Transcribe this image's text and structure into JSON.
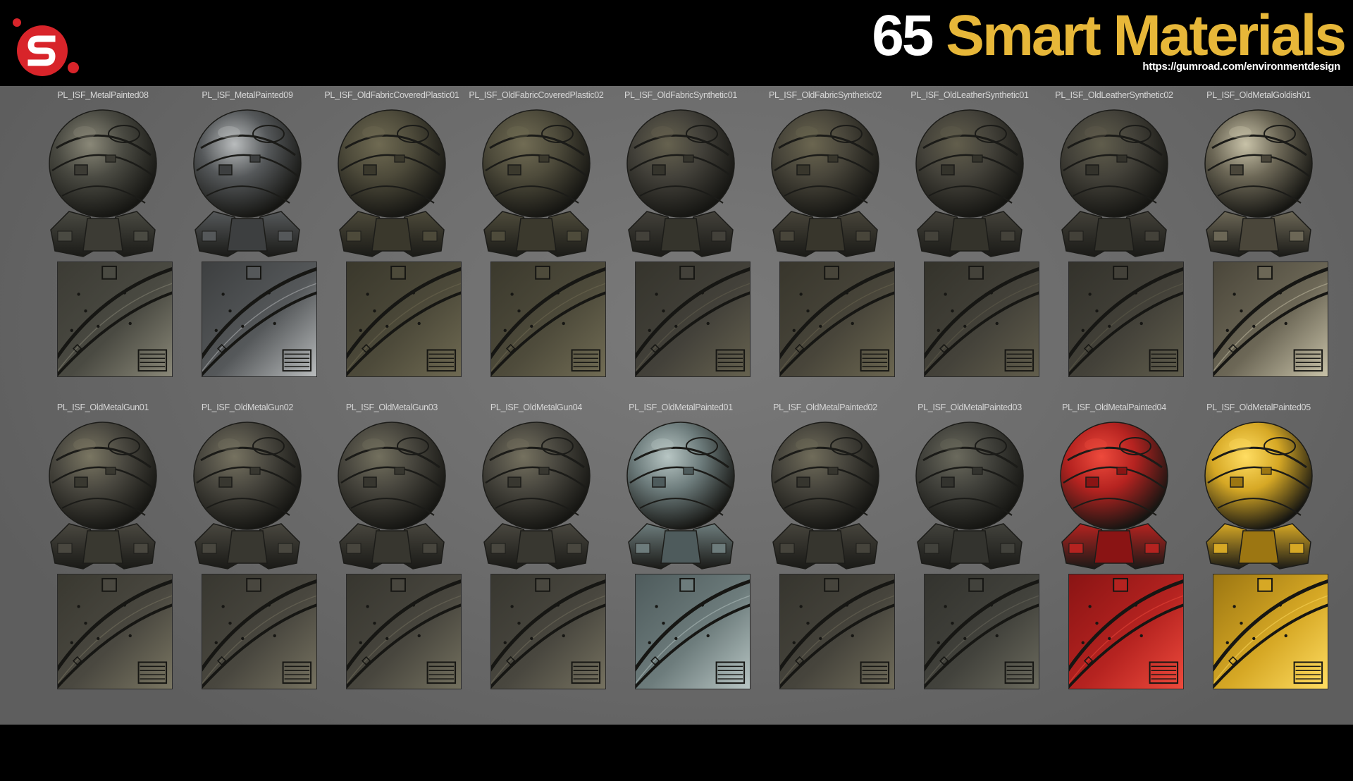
{
  "header": {
    "title_number": "65",
    "title_text": "Smart Materials",
    "url": "https://gumroad.com/environmentdesign",
    "logo_icon": "substance-s-logo-icon",
    "title_color": "#e7b739"
  },
  "rows": [
    {
      "materials": [
        {
          "name": "PL_ISF_MetalPainted08",
          "base": "#3c3b34",
          "hi": "#8a8878",
          "tint": "#4a4a42"
        },
        {
          "name": "PL_ISF_MetalPainted09",
          "base": "#3d3f40",
          "hi": "#b9bcbd",
          "tint": "#55585a"
        },
        {
          "name": "PL_ISF_OldFabricCoveredPlastic01",
          "base": "#3a382c",
          "hi": "#6f6a52",
          "tint": "#4d4a3a"
        },
        {
          "name": "PL_ISF_OldFabricCoveredPlastic02",
          "base": "#3b392d",
          "hi": "#716c54",
          "tint": "#4e4b3b"
        },
        {
          "name": "PL_ISF_OldFabricSynthetic01",
          "base": "#35342c",
          "hi": "#66624f",
          "tint": "#43413a"
        },
        {
          "name": "PL_ISF_OldFabricSynthetic02",
          "base": "#38362c",
          "hi": "#6b6650",
          "tint": "#48453a"
        },
        {
          "name": "PL_ISF_OldLeatherSynthetic01",
          "base": "#34332b",
          "hi": "#625e4c",
          "tint": "#44423a"
        },
        {
          "name": "PL_ISF_OldLeatherSynthetic02",
          "base": "#33322b",
          "hi": "#605d4c",
          "tint": "#434139"
        },
        {
          "name": "PL_ISF_OldMetalGoldish01",
          "base": "#4a463a",
          "hi": "#c8c2a8",
          "tint": "#6c6756"
        }
      ]
    },
    {
      "materials": [
        {
          "name": "PL_ISF_OldMetalGun01",
          "base": "#393830",
          "hi": "#7a7662",
          "tint": "#4a4840"
        },
        {
          "name": "PL_ISF_OldMetalGun02",
          "base": "#383730",
          "hi": "#767260",
          "tint": "#49473f"
        },
        {
          "name": "PL_ISF_OldMetalGun03",
          "base": "#37362f",
          "hi": "#73705e",
          "tint": "#48463e"
        },
        {
          "name": "PL_ISF_OldMetalGun04",
          "base": "#383730",
          "hi": "#75715f",
          "tint": "#49473f"
        },
        {
          "name": "PL_ISF_OldMetalPainted01",
          "base": "#4e5b5c",
          "hi": "#b8c6c4",
          "tint": "#6d7c7c"
        },
        {
          "name": "PL_ISF_OldMetalPainted02",
          "base": "#36352e",
          "hi": "#706c5a",
          "tint": "#46443c"
        },
        {
          "name": "PL_ISF_OldMetalPainted03",
          "base": "#33332e",
          "hi": "#6b6a5d",
          "tint": "#42423c"
        },
        {
          "name": "PL_ISF_OldMetalPainted04",
          "base": "#8a1414",
          "hi": "#ee4a3c",
          "tint": "#b52320"
        },
        {
          "name": "PL_ISF_OldMetalPainted05",
          "base": "#9c7612",
          "hi": "#ffdd62",
          "tint": "#d6a825"
        }
      ]
    }
  ]
}
